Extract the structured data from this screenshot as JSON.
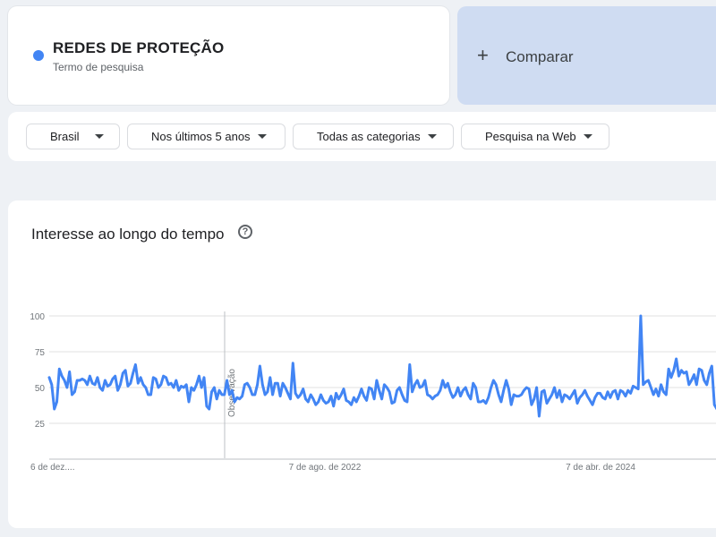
{
  "term": {
    "name": "REDES DE PROTEÇÃO",
    "subtitle": "Termo de pesquisa",
    "color": "#4285f4"
  },
  "compare": {
    "icon": "plus-icon",
    "plus": "+",
    "label": "Comparar"
  },
  "filters": [
    {
      "label": "Brasil",
      "icon": "dropdown-arrow-icon"
    },
    {
      "label": "Nos últimos 5 anos",
      "icon": "dropdown-arrow-icon"
    },
    {
      "label": "Todas as categorias",
      "icon": "dropdown-arrow-icon"
    },
    {
      "label": "Pesquisa na Web",
      "icon": "dropdown-arrow-icon"
    }
  ],
  "chart": {
    "title": "Interesse ao longo do tempo",
    "help_icon": "?",
    "note_label": "Observação"
  },
  "chart_data": {
    "type": "line",
    "title": "Interesse ao longo do tempo",
    "xlabel": "",
    "ylabel": "",
    "ylim": [
      0,
      100
    ],
    "grid": true,
    "yticks": [
      25,
      50,
      75,
      100
    ],
    "xtick_labels": [
      "6 de dez....",
      "7 de ago. de 2022",
      "7 de abr. de 2024"
    ],
    "annotation": "Observação",
    "series": [
      {
        "name": "REDES DE PROTEÇÃO",
        "color": "#4285f4",
        "values": [
          57,
          52,
          35,
          40,
          63,
          58,
          55,
          50,
          61,
          45,
          47,
          55,
          55,
          56,
          55,
          52,
          58,
          53,
          52,
          57,
          50,
          48,
          55,
          51,
          52,
          56,
          58,
          48,
          52,
          60,
          62,
          51,
          53,
          60,
          66,
          53,
          57,
          52,
          50,
          45,
          45,
          57,
          56,
          50,
          52,
          58,
          57,
          52,
          53,
          50,
          55,
          48,
          51,
          50,
          52,
          40,
          50,
          48,
          52,
          58,
          50,
          57,
          37,
          35,
          47,
          50,
          42,
          48,
          45,
          45,
          55,
          45,
          48,
          40,
          43,
          42,
          44,
          52,
          53,
          50,
          45,
          45,
          52,
          65,
          52,
          45,
          47,
          57,
          45,
          53,
          53,
          44,
          53,
          50,
          46,
          42,
          67,
          46,
          43,
          45,
          49,
          42,
          40,
          45,
          42,
          38,
          40,
          45,
          41,
          39,
          40,
          44,
          37,
          46,
          42,
          45,
          49,
          41,
          40,
          38,
          43,
          40,
          44,
          49,
          44,
          41,
          50,
          49,
          42,
          55,
          48,
          42,
          52,
          50,
          47,
          39,
          40,
          48,
          50,
          45,
          41,
          40,
          66,
          47,
          52,
          55,
          50,
          51,
          55,
          45,
          44,
          42,
          44,
          45,
          48,
          55,
          50,
          53,
          47,
          43,
          45,
          50,
          44,
          48,
          50,
          45,
          42,
          53,
          50,
          40,
          40,
          41,
          39,
          43,
          50,
          55,
          52,
          45,
          40,
          48,
          55,
          49,
          38,
          45,
          44,
          44,
          45,
          48,
          50,
          49,
          38,
          42,
          50,
          30,
          47,
          48,
          39,
          42,
          45,
          50,
          43,
          48,
          40,
          45,
          44,
          42,
          45,
          48,
          39,
          43,
          45,
          48,
          44,
          41,
          38,
          43,
          46,
          46,
          43,
          42,
          47,
          43,
          47,
          48,
          42,
          48,
          47,
          44,
          48,
          46,
          51,
          50,
          49,
          100,
          52,
          54,
          55,
          50,
          45,
          49,
          44,
          52,
          47,
          45,
          63,
          57,
          62,
          70,
          58,
          62,
          60,
          61,
          52,
          55,
          59,
          52,
          63,
          62,
          55,
          52,
          60,
          65,
          38,
          35
        ]
      }
    ]
  }
}
